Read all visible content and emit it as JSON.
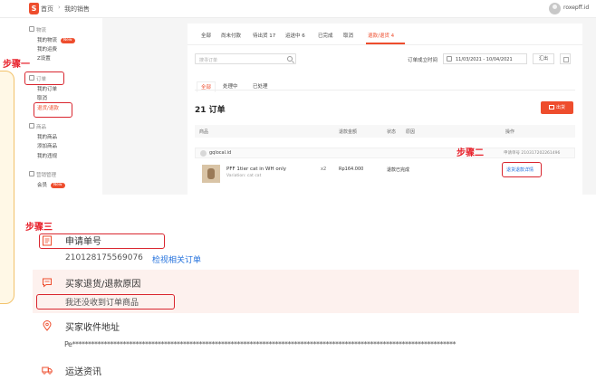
{
  "header": {
    "home_label": "首页",
    "separator": "›",
    "page_label": "我的销售",
    "username": "roxepff.id"
  },
  "sidebar": {
    "sections": [
      {
        "title": "物流",
        "items": [
          "我的物流",
          "我的运费",
          "Z设置"
        ]
      },
      {
        "title": "订单",
        "items": [
          "我的订单",
          "取消",
          "退货/退款"
        ]
      },
      {
        "title": "商品",
        "items": [
          "我的商品",
          "添加商品",
          "我的违规"
        ]
      },
      {
        "title": "营销管理",
        "items": [
          "会员"
        ]
      }
    ],
    "badge_new": "New",
    "badge_vip": "New"
  },
  "order_panel": {
    "tabs": [
      "全部",
      "尚未付款",
      "待出货 17",
      "运送中 6",
      "已完成",
      "取消",
      "退款/退货 4"
    ],
    "search_placeholder": "搜寻订单",
    "date_label": "订单成立时间",
    "date_range": "11/03/2021 - 10/04/2021",
    "export_label": "汇出",
    "subtabs": [
      "全部",
      "处理中",
      "已处理"
    ],
    "count_title": "21 订单",
    "ship_button": "出货",
    "columns": [
      "商品",
      "退款金额",
      "状态",
      "原因",
      "操作"
    ],
    "buyer_name": "gqlocal.id",
    "request_no_text": "申请单号 210317202261496",
    "product": {
      "name": "PFF 1tier cat in WH only",
      "variant": "Variation: cat cat",
      "qty": "x2",
      "price": "Rp164.000",
      "status": "退款已完成",
      "action": "退货退款详情"
    }
  },
  "annotations": {
    "step1": "步骤一",
    "step2": "步骤二",
    "step3": "步骤三"
  },
  "detail": {
    "request_title": "申请单号",
    "request_number": "210128175569076",
    "view_link": "检视相关订单",
    "reason_title": "买家退货/退款原因",
    "reason_text": "我还没收到订单商品",
    "address_title": "买家收件地址",
    "address_masked": "Pe*************************************************************************************************************************",
    "shipping_title": "运送资讯"
  },
  "colors": {
    "brand": "#ee4d2d",
    "annotation_red": "#e8212b",
    "link_blue": "#2673dd"
  }
}
